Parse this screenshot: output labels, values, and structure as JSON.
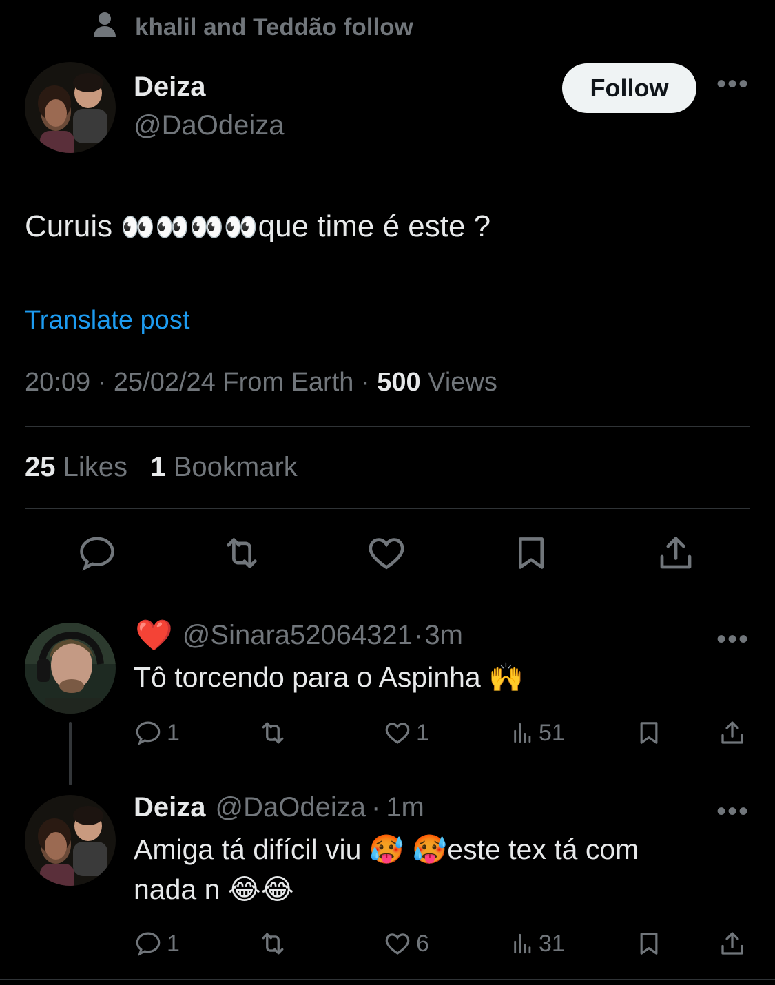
{
  "social_context": {
    "text": "khalil and Teddão follow"
  },
  "main_tweet": {
    "author_name": "Deiza",
    "author_handle": "@DaOdeiza",
    "follow_label": "Follow",
    "more_label": "•••",
    "text_before": "Curuis ",
    "emojis": "👀👀👀👀",
    "text_after": "que time é este ?",
    "translate_label": "Translate post",
    "time": "20:09",
    "date": "25/02/24",
    "source": "From Earth",
    "views_count": "500",
    "views_label": "Views",
    "likes_count": "25",
    "likes_label": "Likes",
    "bookmarks_count": "1",
    "bookmarks_label": "Bookmark"
  },
  "replies": [
    {
      "badge": "❤️",
      "author_handle": "@Sinara52064321",
      "separator": "·",
      "time": "3m",
      "text": "Tô torcendo para o Aspinha 🙌",
      "reply_count": "1",
      "like_count": "1",
      "view_count": "51"
    },
    {
      "author_name": "Deiza",
      "author_handle": "@DaOdeiza",
      "separator": "·",
      "time": "1m",
      "text_line1": "Amiga tá difícil viu 🥵 🥵este tex tá com",
      "text_line2": "nada n 😂😂",
      "reply_count": "1",
      "like_count": "6",
      "view_count": "31"
    }
  ],
  "colors": {
    "background": "#000000",
    "text": "#e7e9ea",
    "secondary": "#71767b",
    "link": "#1d9bf0",
    "divider": "#2f3336"
  }
}
